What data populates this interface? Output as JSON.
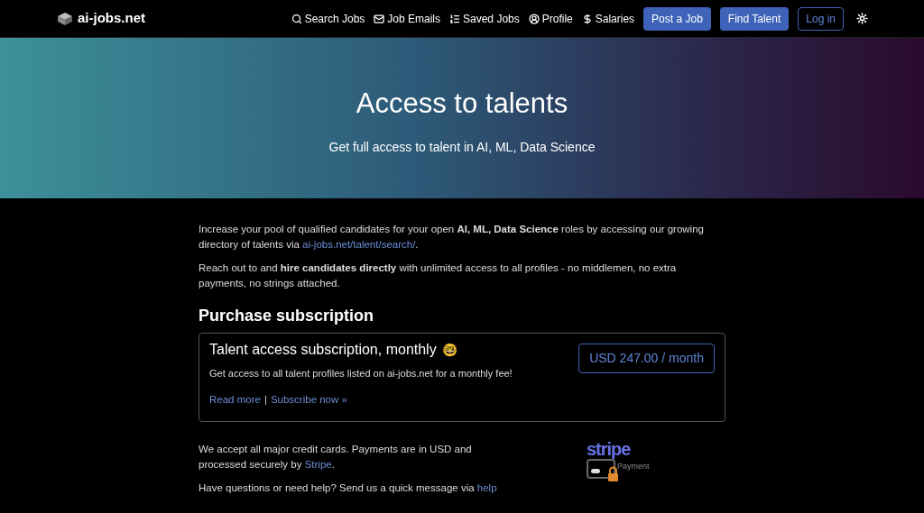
{
  "navbar": {
    "brand": "ai-jobs.net",
    "links": [
      {
        "label": "Search Jobs"
      },
      {
        "label": "Job Emails"
      },
      {
        "label": "Saved Jobs"
      },
      {
        "label": "Profile"
      },
      {
        "label": "Salaries"
      }
    ],
    "buttons": [
      {
        "label": "Post a Job",
        "kind": "filled"
      },
      {
        "label": "Find Talent",
        "kind": "filled"
      },
      {
        "label": "Log in",
        "kind": "outline"
      }
    ]
  },
  "hero": {
    "title": "Access to talents",
    "subtitle": "Get full access to talent in AI, ML, Data Science"
  },
  "intro": [
    {
      "text": "Increase your pool of qualified candidates for your open **AI, ML, Data Science** roles by accessing our growing directory of talents via ",
      "link": "ai-jobs.net/talent/search/",
      "after": "."
    },
    {
      "text": "Reach out to and **hire candidates directly** with unlimited access to all profiles - no middlemen, no extra payments, no strings attached."
    }
  ],
  "purchase": {
    "heading": "Purchase subscription",
    "card": {
      "title": "Talent access subscription, monthly",
      "emoji": "🤓",
      "description": "Get access to all talent profiles listed on ai-jobs.net for a monthly fee!",
      "links": [
        "Read more",
        "Subscribe now »"
      ],
      "separator": "|",
      "price": "USD 247.00 / month"
    }
  },
  "payment": {
    "text": "We accept all major credit cards. Payments are in USD and processed securely by ",
    "link": "Stripe",
    "after": ".",
    "logo": {
      "wordmark": "stripe",
      "caption": "Payment"
    }
  },
  "help": {
    "text": "Have questions or need help? Send us a quick message via ",
    "link": "help"
  }
}
